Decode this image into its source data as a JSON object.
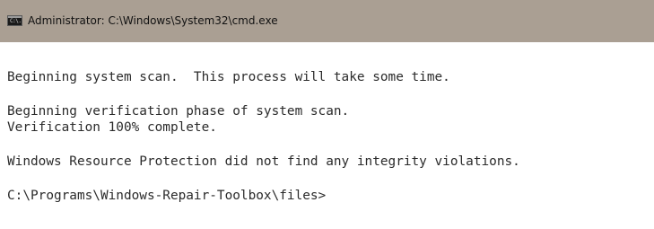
{
  "window": {
    "title": "Administrator: C:\\Windows\\System32\\cmd.exe",
    "icon_name": "cmd-console-icon",
    "icon_label": "C:\\."
  },
  "console": {
    "lines": [
      "Beginning system scan.  This process will take some time.",
      "Beginning verification phase of system scan.",
      "Verification 100% complete.",
      "Windows Resource Protection did not find any integrity violations.",
      "C:\\Programs\\Windows-Repair-Toolbox\\files>"
    ]
  },
  "colors": {
    "titlebar": "#aa9f93",
    "background": "#ffffff",
    "text": "#2b2b2b"
  }
}
